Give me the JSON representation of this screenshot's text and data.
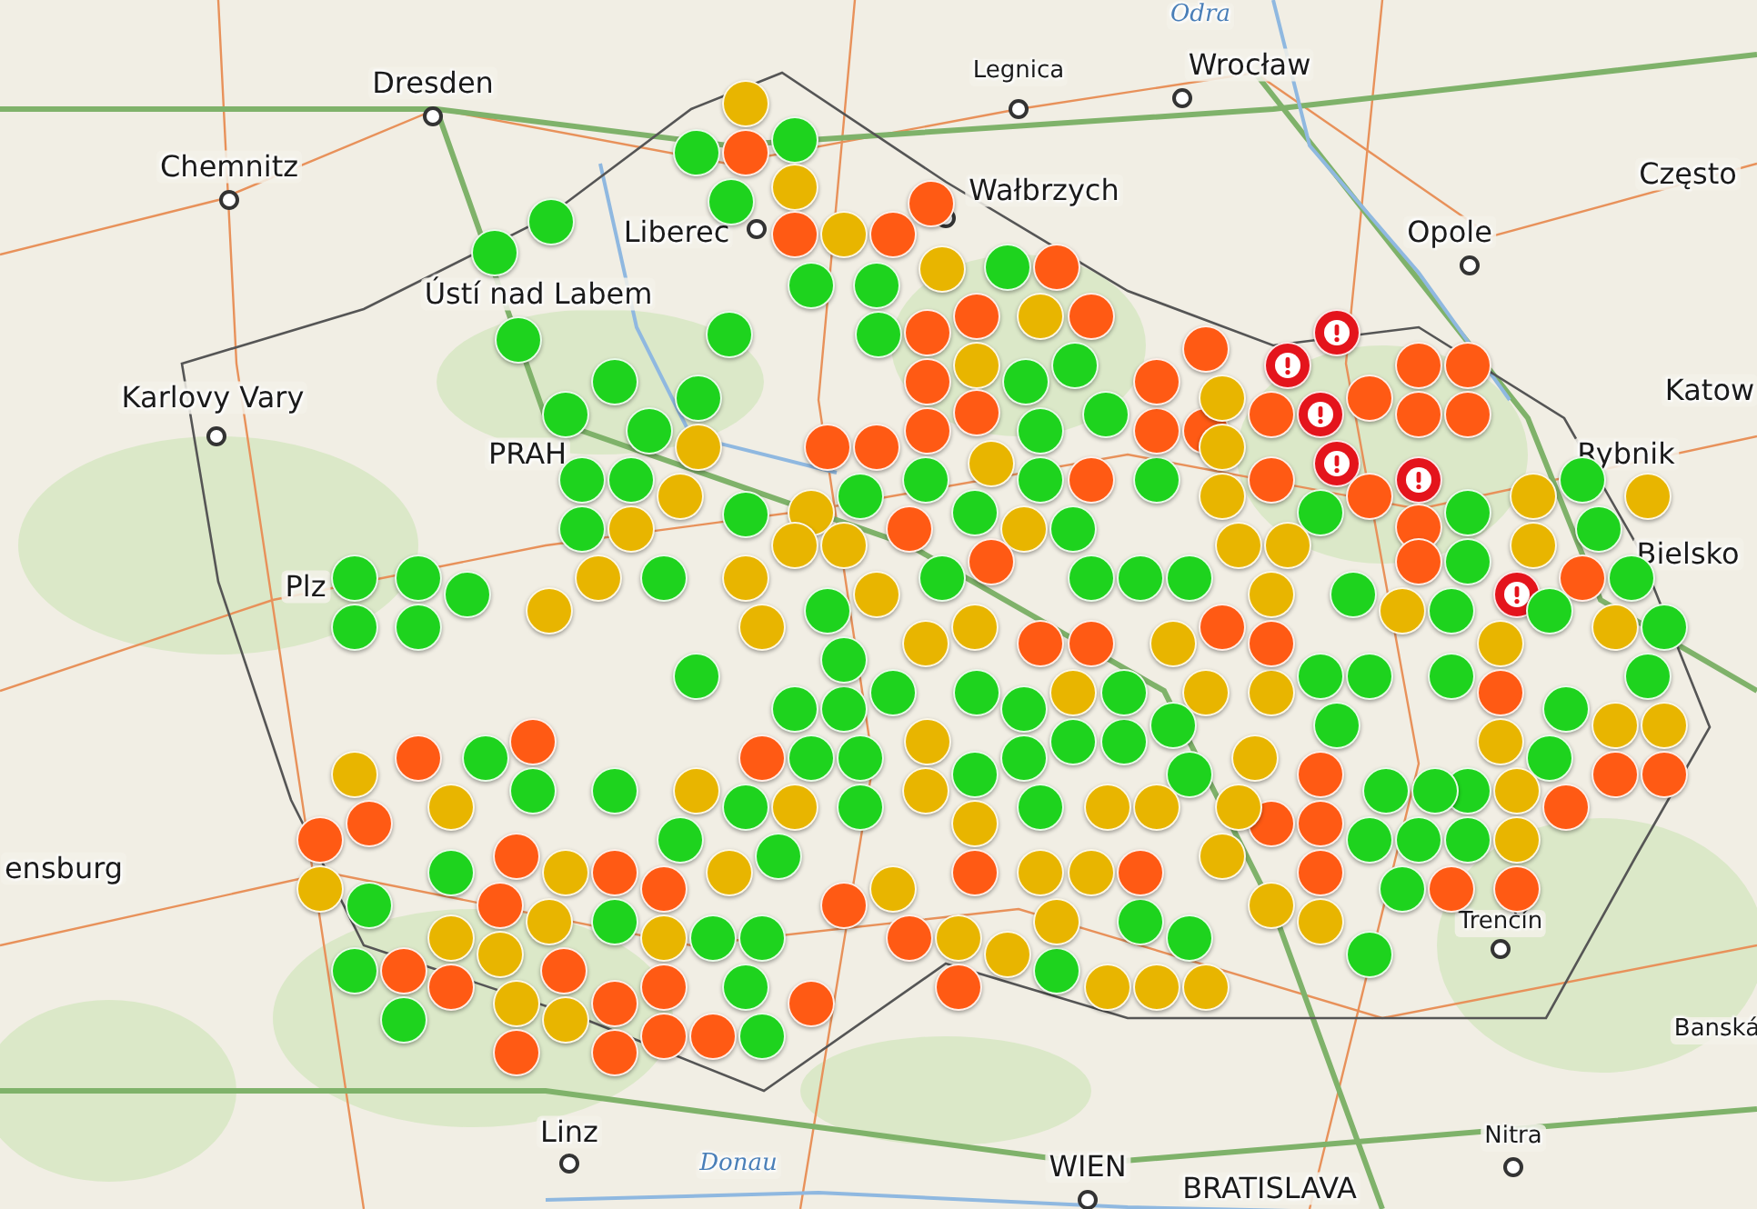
{
  "map": {
    "places": [
      {
        "name": "Odra",
        "kind": "river"
      },
      {
        "name": "Legnica",
        "kind": "town"
      },
      {
        "name": "Wrocław",
        "kind": "city"
      },
      {
        "name": "Dresden",
        "kind": "city"
      },
      {
        "name": "Chemnitz",
        "kind": "city"
      },
      {
        "name": "Wałbrzych",
        "kind": "city"
      },
      {
        "name": "Często",
        "kind": "city"
      },
      {
        "name": "Liberec",
        "kind": "city"
      },
      {
        "name": "Opole",
        "kind": "city"
      },
      {
        "name": "Ústí nad Labem",
        "kind": "city"
      },
      {
        "name": "Karlovy Vary",
        "kind": "city"
      },
      {
        "name": "Katow",
        "kind": "city"
      },
      {
        "name": "PRAH",
        "kind": "city"
      },
      {
        "name": "Rybnik",
        "kind": "city"
      },
      {
        "name": "Bielsko",
        "kind": "city"
      },
      {
        "name": "Plz",
        "kind": "city"
      },
      {
        "name": "ensburg",
        "kind": "city"
      },
      {
        "name": "Trenčín",
        "kind": "town"
      },
      {
        "name": "Banská",
        "kind": "town"
      },
      {
        "name": "Linz",
        "kind": "city"
      },
      {
        "name": "Nitra",
        "kind": "town"
      },
      {
        "name": "Donau",
        "kind": "river"
      },
      {
        "name": "WIEN",
        "kind": "city"
      },
      {
        "name": "BRATISLAVA",
        "kind": "city"
      }
    ],
    "markers": [
      {
        "color": "#e8b500",
        "kind": "dot"
      },
      {
        "color": "#1ed31e",
        "kind": "dot"
      },
      {
        "color": "#ff5a14",
        "kind": "dot"
      },
      {
        "color": "#1ed31e",
        "kind": "dot"
      },
      {
        "color": "#e8b500",
        "kind": "dot"
      },
      {
        "color": "#1ed31e",
        "kind": "dot"
      },
      {
        "color": "#ff5a14",
        "kind": "dot"
      },
      {
        "color": "#e8b500",
        "kind": "dot"
      },
      {
        "color": "#ff5a14",
        "kind": "dot"
      },
      {
        "color": "#ff5a14",
        "kind": "dot"
      },
      {
        "color": "#1ed31e",
        "kind": "dot"
      },
      {
        "color": "#1ed31e",
        "kind": "dot"
      },
      {
        "color": "#e8b500",
        "kind": "dot"
      },
      {
        "color": "#1ed31e",
        "kind": "dot"
      },
      {
        "color": "#ff5a14",
        "kind": "dot"
      },
      {
        "color": "#e8b500",
        "kind": "dot"
      },
      {
        "color": "#ff5a14",
        "kind": "dot"
      },
      {
        "color": "#1ed31e",
        "kind": "dot"
      },
      {
        "color": "#1ed31e",
        "kind": "dot"
      },
      {
        "color": "#1ed31e",
        "kind": "dot"
      },
      {
        "color": "#1ed31e",
        "kind": "dot"
      },
      {
        "color": "#1ed31e",
        "kind": "dot"
      },
      {
        "color": "#ff5a14",
        "kind": "dot"
      },
      {
        "color": "#ff5a14",
        "kind": "dot"
      },
      {
        "color": "#ff5a14",
        "kind": "dot"
      },
      {
        "color": "#e8b500",
        "kind": "dot"
      },
      {
        "color": "#1ed31e",
        "kind": "dot"
      },
      {
        "color": "#1ed31e",
        "kind": "dot"
      },
      {
        "color": "#ff5a14",
        "kind": "dot"
      },
      {
        "color": "#ff5a14",
        "kind": "dot"
      },
      {
        "color": "#1ed31e",
        "kind": "dot"
      },
      {
        "color": "#1ed31e",
        "kind": "dot"
      },
      {
        "color": "#1ed31e",
        "kind": "dot"
      },
      {
        "color": "#1ed31e",
        "kind": "dot"
      },
      {
        "color": "#e8b500",
        "kind": "dot"
      },
      {
        "color": "#ff5a14",
        "kind": "dot"
      },
      {
        "color": "#ff5a14",
        "kind": "dot"
      },
      {
        "color": "#e8b500",
        "kind": "dot"
      },
      {
        "color": "#1ed31e",
        "kind": "dot"
      },
      {
        "color": "#1ed31e",
        "kind": "dot"
      },
      {
        "color": "#1ed31e",
        "kind": "dot"
      },
      {
        "color": "#1ed31e",
        "kind": "dot"
      },
      {
        "color": "#e8b500",
        "kind": "dot"
      },
      {
        "color": "#1ed31e",
        "kind": "dot"
      },
      {
        "color": "#e8b500",
        "kind": "dot"
      },
      {
        "color": "#1ed31e",
        "kind": "dot"
      },
      {
        "color": "#1ed31e",
        "kind": "dot"
      },
      {
        "color": "#1ed31e",
        "kind": "dot"
      },
      {
        "color": "#ff5a14",
        "kind": "dot"
      },
      {
        "color": "#1ed31e",
        "kind": "dot"
      },
      {
        "color": "#ff5a14",
        "kind": "dot"
      },
      {
        "color": "#ff5a14",
        "kind": "dot"
      },
      {
        "color": "#ff5a14",
        "kind": "dot"
      },
      {
        "color": "#ff5a14",
        "kind": "dot"
      },
      {
        "color": "#e8b500",
        "kind": "dot"
      },
      {
        "color": "#ff5a14",
        "kind": "dot"
      },
      {
        "color": "#e4141c",
        "kind": "alert"
      },
      {
        "color": "#e4141c",
        "kind": "alert"
      },
      {
        "color": "#e4141c",
        "kind": "alert"
      },
      {
        "color": "#e4141c",
        "kind": "alert"
      },
      {
        "color": "#ff5a14",
        "kind": "dot"
      },
      {
        "color": "#ff5a14",
        "kind": "dot"
      },
      {
        "color": "#ff5a14",
        "kind": "dot"
      },
      {
        "color": "#ff5a14",
        "kind": "dot"
      },
      {
        "color": "#ff5a14",
        "kind": "dot"
      },
      {
        "color": "#e4141c",
        "kind": "alert"
      },
      {
        "color": "#e8b500",
        "kind": "dot"
      },
      {
        "color": "#ff5a14",
        "kind": "dot"
      },
      {
        "color": "#e8b500",
        "kind": "dot"
      },
      {
        "color": "#1ed31e",
        "kind": "dot"
      },
      {
        "color": "#ff5a14",
        "kind": "dot"
      },
      {
        "color": "#ff5a14",
        "kind": "dot"
      },
      {
        "color": "#1ed31e",
        "kind": "dot"
      },
      {
        "color": "#e8b500",
        "kind": "dot"
      },
      {
        "color": "#1ed31e",
        "kind": "dot"
      },
      {
        "color": "#e8b500",
        "kind": "dot"
      },
      {
        "color": "#e8b500",
        "kind": "dot"
      },
      {
        "color": "#1ed31e",
        "kind": "dot"
      },
      {
        "color": "#ff5a14",
        "kind": "dot"
      },
      {
        "color": "#1ed31e",
        "kind": "dot"
      },
      {
        "color": "#e4141c",
        "kind": "alert"
      },
      {
        "color": "#1ed31e",
        "kind": "dot"
      },
      {
        "color": "#ff5a14",
        "kind": "dot"
      },
      {
        "color": "#1ed31e",
        "kind": "dot"
      },
      {
        "color": "#e8b500",
        "kind": "dot"
      },
      {
        "color": "#1ed31e",
        "kind": "dot"
      },
      {
        "color": "#e8b500",
        "kind": "dot"
      },
      {
        "color": "#1ed31e",
        "kind": "dot"
      },
      {
        "color": "#e8b500",
        "kind": "dot"
      },
      {
        "color": "#1ed31e",
        "kind": "dot"
      },
      {
        "color": "#1ed31e",
        "kind": "dot"
      },
      {
        "color": "#1ed31e",
        "kind": "dot"
      },
      {
        "color": "#ff5a14",
        "kind": "dot"
      },
      {
        "color": "#1ed31e",
        "kind": "dot"
      },
      {
        "color": "#e8b500",
        "kind": "dot"
      },
      {
        "color": "#1ed31e",
        "kind": "dot"
      },
      {
        "color": "#e8b500",
        "kind": "dot"
      },
      {
        "color": "#e8b500",
        "kind": "dot"
      },
      {
        "color": "#ff5a14",
        "kind": "dot"
      },
      {
        "color": "#ff5a14",
        "kind": "dot"
      },
      {
        "color": "#ff5a14",
        "kind": "dot"
      },
      {
        "color": "#e8b500",
        "kind": "dot"
      },
      {
        "color": "#1ed31e",
        "kind": "dot"
      },
      {
        "color": "#1ed31e",
        "kind": "dot"
      },
      {
        "color": "#1ed31e",
        "kind": "dot"
      },
      {
        "color": "#1ed31e",
        "kind": "dot"
      },
      {
        "color": "#1ed31e",
        "kind": "dot"
      },
      {
        "color": "#1ed31e",
        "kind": "dot"
      },
      {
        "color": "#e8b500",
        "kind": "dot"
      },
      {
        "color": "#ff5a14",
        "kind": "dot"
      },
      {
        "color": "#ff5a14",
        "kind": "dot"
      },
      {
        "color": "#1ed31e",
        "kind": "dot"
      },
      {
        "color": "#1ed31e",
        "kind": "dot"
      },
      {
        "color": "#1ed31e",
        "kind": "dot"
      },
      {
        "color": "#1ed31e",
        "kind": "dot"
      },
      {
        "color": "#e8b500",
        "kind": "dot"
      },
      {
        "color": "#e8b500",
        "kind": "dot"
      },
      {
        "color": "#1ed31e",
        "kind": "dot"
      },
      {
        "color": "#1ed31e",
        "kind": "dot"
      },
      {
        "color": "#1ed31e",
        "kind": "dot"
      },
      {
        "color": "#e8b500",
        "kind": "dot"
      },
      {
        "color": "#1ed31e",
        "kind": "dot"
      },
      {
        "color": "#1ed31e",
        "kind": "dot"
      },
      {
        "color": "#1ed31e",
        "kind": "dot"
      },
      {
        "color": "#1ed31e",
        "kind": "dot"
      },
      {
        "color": "#1ed31e",
        "kind": "dot"
      },
      {
        "color": "#1ed31e",
        "kind": "dot"
      },
      {
        "color": "#1ed31e",
        "kind": "dot"
      },
      {
        "color": "#e8b500",
        "kind": "dot"
      },
      {
        "color": "#e8b500",
        "kind": "dot"
      },
      {
        "color": "#1ed31e",
        "kind": "dot"
      },
      {
        "color": "#e8b500",
        "kind": "dot"
      },
      {
        "color": "#e8b500",
        "kind": "dot"
      },
      {
        "color": "#e8b500",
        "kind": "dot"
      },
      {
        "color": "#e8b500",
        "kind": "dot"
      },
      {
        "color": "#ff5a14",
        "kind": "dot"
      },
      {
        "color": "#1ed31e",
        "kind": "dot"
      },
      {
        "color": "#e8b500",
        "kind": "dot"
      },
      {
        "color": "#1ed31e",
        "kind": "dot"
      },
      {
        "color": "#ff5a14",
        "kind": "dot"
      },
      {
        "color": "#1ed31e",
        "kind": "dot"
      },
      {
        "color": "#e8b500",
        "kind": "dot"
      },
      {
        "color": "#1ed31e",
        "kind": "dot"
      },
      {
        "color": "#e8b500",
        "kind": "dot"
      },
      {
        "color": "#1ed31e",
        "kind": "dot"
      },
      {
        "color": "#e8b500",
        "kind": "dot"
      },
      {
        "color": "#e8b500",
        "kind": "dot"
      },
      {
        "color": "#ff5a14",
        "kind": "dot"
      },
      {
        "color": "#ff5a14",
        "kind": "dot"
      },
      {
        "color": "#1ed31e",
        "kind": "dot"
      },
      {
        "color": "#1ed31e",
        "kind": "dot"
      },
      {
        "color": "#1ed31e",
        "kind": "dot"
      },
      {
        "color": "#e8b500",
        "kind": "dot"
      },
      {
        "color": "#e8b500",
        "kind": "dot"
      },
      {
        "color": "#e8b500",
        "kind": "dot"
      },
      {
        "color": "#ff5a14",
        "kind": "dot"
      },
      {
        "color": "#ff5a14",
        "kind": "dot"
      },
      {
        "color": "#e8b500",
        "kind": "dot"
      },
      {
        "color": "#1ed31e",
        "kind": "dot"
      },
      {
        "color": "#1ed31e",
        "kind": "dot"
      },
      {
        "color": "#1ed31e",
        "kind": "dot"
      },
      {
        "color": "#1ed31e",
        "kind": "dot"
      },
      {
        "color": "#1ed31e",
        "kind": "dot"
      },
      {
        "color": "#ff5a14",
        "kind": "dot"
      },
      {
        "color": "#1ed31e",
        "kind": "dot"
      },
      {
        "color": "#1ed31e",
        "kind": "dot"
      },
      {
        "color": "#e8b500",
        "kind": "dot"
      },
      {
        "color": "#1ed31e",
        "kind": "dot"
      },
      {
        "color": "#1ed31e",
        "kind": "dot"
      },
      {
        "color": "#1ed31e",
        "kind": "dot"
      },
      {
        "color": "#1ed31e",
        "kind": "dot"
      },
      {
        "color": "#e8b500",
        "kind": "dot"
      },
      {
        "color": "#ff5a14",
        "kind": "dot"
      },
      {
        "color": "#ff5a14",
        "kind": "dot"
      },
      {
        "color": "#ff5a14",
        "kind": "dot"
      },
      {
        "color": "#e8b500",
        "kind": "dot"
      },
      {
        "color": "#ff5a14",
        "kind": "dot"
      },
      {
        "color": "#e8b500",
        "kind": "dot"
      },
      {
        "color": "#e8b500",
        "kind": "dot"
      },
      {
        "color": "#e8b500",
        "kind": "dot"
      },
      {
        "color": "#e8b500",
        "kind": "dot"
      },
      {
        "color": "#e8b500",
        "kind": "dot"
      },
      {
        "color": "#1ed31e",
        "kind": "dot"
      },
      {
        "color": "#e8b500",
        "kind": "dot"
      },
      {
        "color": "#e8b500",
        "kind": "dot"
      },
      {
        "color": "#1ed31e",
        "kind": "dot"
      },
      {
        "color": "#e8b500",
        "kind": "dot"
      },
      {
        "color": "#1ed31e",
        "kind": "dot"
      },
      {
        "color": "#e8b500",
        "kind": "dot"
      },
      {
        "color": "#1ed31e",
        "kind": "dot"
      },
      {
        "color": "#e8b500",
        "kind": "dot"
      },
      {
        "color": "#1ed31e",
        "kind": "dot"
      },
      {
        "color": "#e8b500",
        "kind": "dot"
      },
      {
        "color": "#ff5a14",
        "kind": "dot"
      },
      {
        "color": "#1ed31e",
        "kind": "dot"
      },
      {
        "color": "#ff5a14",
        "kind": "dot"
      },
      {
        "color": "#1ed31e",
        "kind": "dot"
      },
      {
        "color": "#1ed31e",
        "kind": "dot"
      },
      {
        "color": "#e8b500",
        "kind": "dot"
      },
      {
        "color": "#ff5a14",
        "kind": "dot"
      },
      {
        "color": "#ff5a14",
        "kind": "dot"
      },
      {
        "color": "#e8b500",
        "kind": "dot"
      },
      {
        "color": "#1ed31e",
        "kind": "dot"
      },
      {
        "color": "#1ed31e",
        "kind": "dot"
      },
      {
        "color": "#ff5a14",
        "kind": "dot"
      },
      {
        "color": "#e8b500",
        "kind": "dot"
      },
      {
        "color": "#ff5a14",
        "kind": "dot"
      },
      {
        "color": "#ff5a14",
        "kind": "dot"
      },
      {
        "color": "#ff5a14",
        "kind": "dot"
      },
      {
        "color": "#e8b500",
        "kind": "dot"
      },
      {
        "color": "#1ed31e",
        "kind": "dot"
      },
      {
        "color": "#e8b500",
        "kind": "dot"
      },
      {
        "color": "#1ed31e",
        "kind": "dot"
      },
      {
        "color": "#1ed31e",
        "kind": "dot"
      },
      {
        "color": "#e8b500",
        "kind": "dot"
      },
      {
        "color": "#e8b500",
        "kind": "dot"
      },
      {
        "color": "#ff5a14",
        "kind": "dot"
      },
      {
        "color": "#1ed31e",
        "kind": "dot"
      },
      {
        "color": "#ff5a14",
        "kind": "dot"
      },
      {
        "color": "#ff5a14",
        "kind": "dot"
      },
      {
        "color": "#e8b500",
        "kind": "dot"
      },
      {
        "color": "#e8b500",
        "kind": "dot"
      },
      {
        "color": "#ff5a14",
        "kind": "dot"
      },
      {
        "color": "#ff5a14",
        "kind": "dot"
      },
      {
        "color": "#1ed31e",
        "kind": "dot"
      },
      {
        "color": "#ff5a14",
        "kind": "dot"
      },
      {
        "color": "#1ed31e",
        "kind": "dot"
      },
      {
        "color": "#ff5a14",
        "kind": "dot"
      },
      {
        "color": "#ff5a14",
        "kind": "dot"
      },
      {
        "color": "#ff5a14",
        "kind": "dot"
      },
      {
        "color": "#ff5a14",
        "kind": "dot"
      },
      {
        "color": "#1ed31e",
        "kind": "dot"
      },
      {
        "color": "#ff5a14",
        "kind": "dot"
      },
      {
        "color": "#e8b500",
        "kind": "dot"
      },
      {
        "color": "#ff5a14",
        "kind": "dot"
      },
      {
        "color": "#e8b500",
        "kind": "dot"
      },
      {
        "color": "#e8b500",
        "kind": "dot"
      },
      {
        "color": "#1ed31e",
        "kind": "dot"
      },
      {
        "color": "#e8b500",
        "kind": "dot"
      },
      {
        "color": "#e8b500",
        "kind": "dot"
      },
      {
        "color": "#e8b500",
        "kind": "dot"
      },
      {
        "color": "#1ed31e",
        "kind": "dot"
      },
      {
        "color": "#1ed31e",
        "kind": "dot"
      },
      {
        "color": "#e8b500",
        "kind": "dot"
      },
      {
        "color": "#e8b500",
        "kind": "dot"
      },
      {
        "color": "#e8b500",
        "kind": "dot"
      },
      {
        "color": "#ff5a14",
        "kind": "dot"
      },
      {
        "color": "#ff5a14",
        "kind": "dot"
      },
      {
        "color": "#ff5a14",
        "kind": "dot"
      },
      {
        "color": "#1ed31e",
        "kind": "dot"
      }
    ]
  }
}
